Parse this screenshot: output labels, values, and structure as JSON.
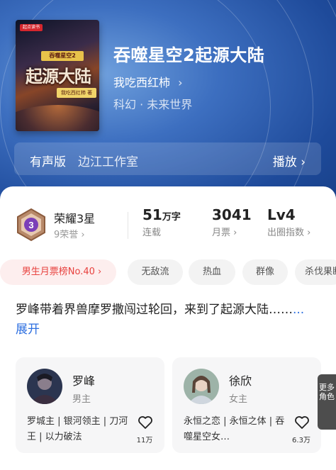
{
  "book": {
    "title": "吞噬星空2起源大陆",
    "author": "我吃西红柿",
    "author_chevron": "›",
    "genre": "科幻 · 未来世界",
    "cover": {
      "brand": "起点读书",
      "subtitle": "吞噬星空2",
      "title": "起源大陆",
      "author_tag": "我吃西红柿 著"
    }
  },
  "audio": {
    "tag": "有声版",
    "studio": "边江工作室",
    "play_label": "播放 ›"
  },
  "honor": {
    "level_number": "3",
    "name": "荣耀3星",
    "sub": "9荣誉 ›"
  },
  "stats": [
    {
      "value": "51",
      "unit": "万字",
      "label": "连载"
    },
    {
      "value": "3041",
      "unit": "",
      "label": "月票 ›"
    },
    {
      "value": "Lv4",
      "unit": "",
      "label": "出圈指数 ›"
    }
  ],
  "tags": {
    "rank": "男生月票榜No.40 ›",
    "items": [
      "无敌流",
      "热血",
      "群像",
      "杀伐果断"
    ]
  },
  "description": {
    "text": "罗峰带着界兽摩罗撒闯过轮回，来到了起源大陆……",
    "more": "...展开"
  },
  "roles": [
    {
      "name": "罗峰",
      "role": "男主",
      "tags": "罗城主 | 银河领主 | 刀河王 | 以力破法",
      "likes": "11万"
    },
    {
      "name": "徐欣",
      "role": "女主",
      "tags": "永恒之恋 | 永恒之体 | 吞噬星空女…",
      "likes": "6.3万"
    }
  ],
  "more_roles": "更多角色",
  "colors": {
    "hero": "#2f62b5",
    "accent": "#e8423f",
    "link": "#2d6fe0"
  },
  "icons": {
    "heart": "heart-icon",
    "badge": "honor-badge-icon"
  }
}
